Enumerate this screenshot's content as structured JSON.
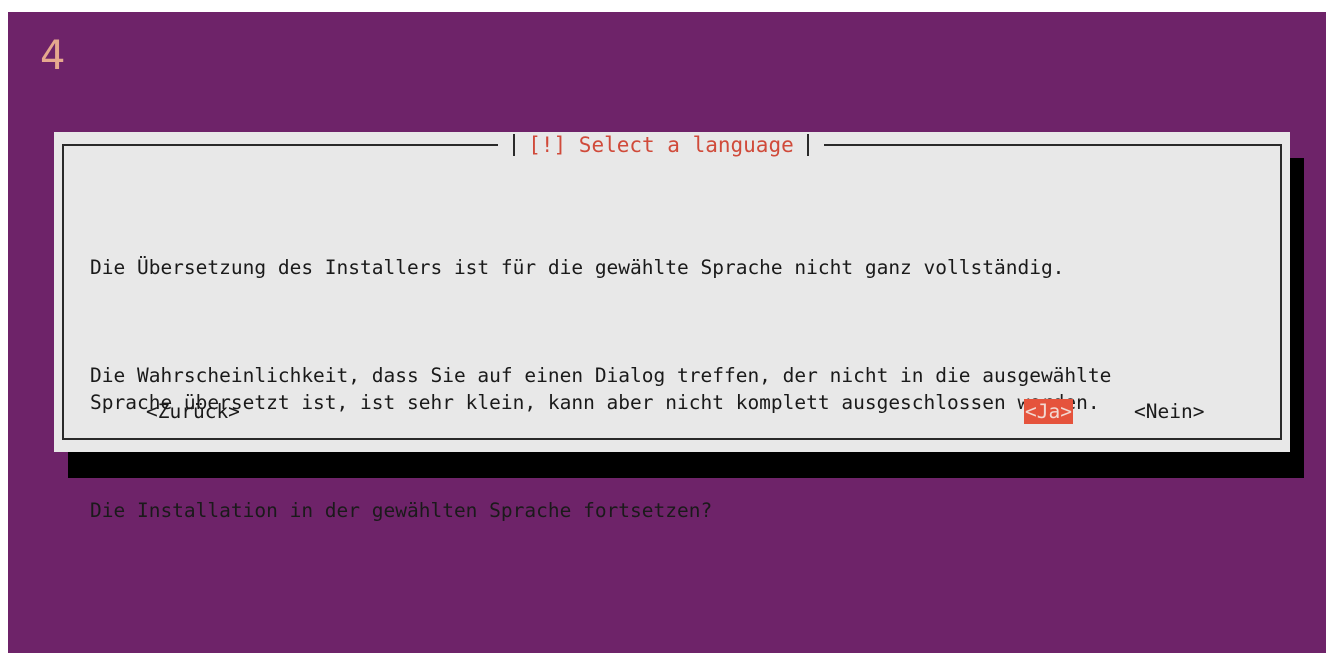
{
  "screen": {
    "corner_number": "4",
    "colors": {
      "background": "#6e2369",
      "dialog": "#e8e8e8",
      "title": "#d04a3a",
      "selected_button": "#e5533c"
    }
  },
  "dialog": {
    "title": "[!] Select a language",
    "paragraphs": [
      "Die Übersetzung des Installers ist für die gewählte Sprache nicht ganz vollständig.",
      "Die Wahrscheinlichkeit, dass Sie auf einen Dialog treffen, der nicht in die ausgewählte\nSprache übersetzt ist, ist sehr klein, kann aber nicht komplett ausgeschlossen werden.",
      "Die Installation in der gewählten Sprache fortsetzen?"
    ],
    "buttons": {
      "back": "<Zurück>",
      "yes": "<Ja>",
      "no": "<Nein>",
      "selected": "yes"
    }
  }
}
